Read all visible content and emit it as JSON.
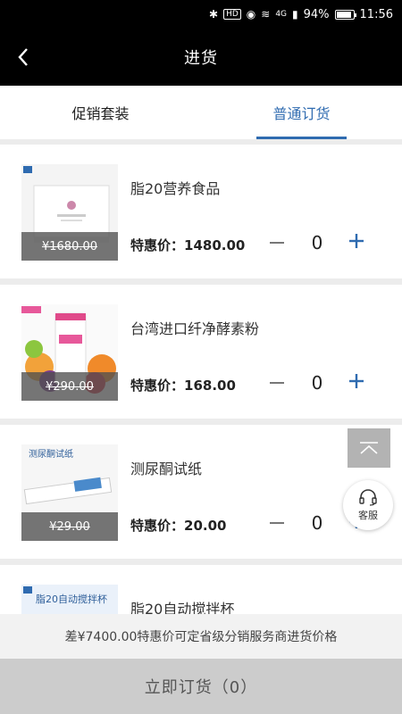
{
  "status_bar": {
    "battery_percent": "94%",
    "battery_level": 0.94,
    "time": "11:56",
    "hd": "HD",
    "network": "4G"
  },
  "header": {
    "title": "进货",
    "back_icon": "chevron-left-icon"
  },
  "tabs": [
    {
      "label": "促销套装",
      "active": false
    },
    {
      "label": "普通订货",
      "active": true
    }
  ],
  "products": [
    {
      "name": "脂20营养食品",
      "original_price": "¥1680.00",
      "deal_label": "特惠价：",
      "deal_price": "1480.00",
      "quantity": "0"
    },
    {
      "name": "台湾进口纤净酵素粉",
      "original_price": "¥290.00",
      "deal_label": "特惠价：",
      "deal_price": "168.00",
      "quantity": "0"
    },
    {
      "name": "测尿酮试纸",
      "original_price": "¥29.00",
      "deal_label": "特惠价：",
      "deal_price": "20.00",
      "quantity": "0"
    },
    {
      "name": "脂20自动搅拌杯",
      "original_price": "",
      "deal_label": "",
      "deal_price": "",
      "quantity": ""
    }
  ],
  "thumb_text": {
    "product3": "测尿酮试纸",
    "product4": "脂20自动搅拌杯"
  },
  "floating": {
    "customer_service_label": "客服"
  },
  "notice": "差¥7400.00特惠价可定省级分销服务商进货价格",
  "order_button": "立即订货（0）",
  "colors": {
    "accent": "#2f6bb0",
    "header_bg": "#000000",
    "page_bg": "#ececec"
  }
}
